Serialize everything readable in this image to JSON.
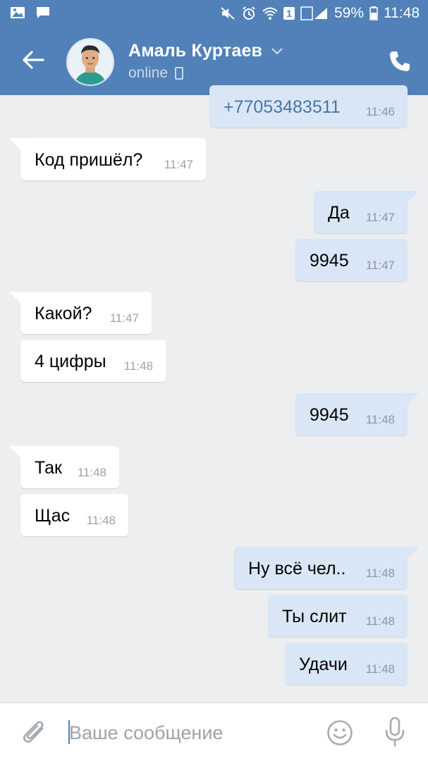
{
  "status_bar": {
    "battery": "59%",
    "time": "11:48",
    "sim": "1",
    "icons": [
      "gallery-icon",
      "chat-icon",
      "mute-icon",
      "alarm-icon",
      "wifi-icon",
      "signal-icon",
      "battery-icon"
    ]
  },
  "header": {
    "contact_name": "Амаль Куртаев",
    "status": "online",
    "colors": {
      "bar": "#5181b8",
      "status_text": "#c9d8ea"
    }
  },
  "messages": [
    {
      "dir": "out",
      "text": "+77053483511",
      "time": "11:46"
    },
    {
      "dir": "in",
      "text": "Код пришёл?",
      "time": "11:47"
    },
    {
      "dir": "out",
      "text": "Да",
      "time": "11:47"
    },
    {
      "dir": "out",
      "text": "9945",
      "time": "11:47"
    },
    {
      "dir": "in",
      "text": "Какой?",
      "time": "11:47"
    },
    {
      "dir": "in",
      "text": "4 цифры",
      "time": "11:48"
    },
    {
      "dir": "out",
      "text": "9945",
      "time": "11:48"
    },
    {
      "dir": "in",
      "text": "Так",
      "time": "11:48"
    },
    {
      "dir": "in",
      "text": "Щас",
      "time": "11:48"
    },
    {
      "dir": "out",
      "text": "Ну всё чел..",
      "time": "11:48"
    },
    {
      "dir": "out",
      "text": "Ты слит",
      "time": "11:48"
    },
    {
      "dir": "out",
      "text": "Удачи",
      "time": "11:48"
    }
  ],
  "composer": {
    "placeholder": "Ваше сообщение"
  },
  "theme": {
    "background": "#edeef0",
    "incoming_bubble": "#ffffff",
    "outgoing_bubble": "#d9e6f5",
    "accent": "#5181b8"
  }
}
